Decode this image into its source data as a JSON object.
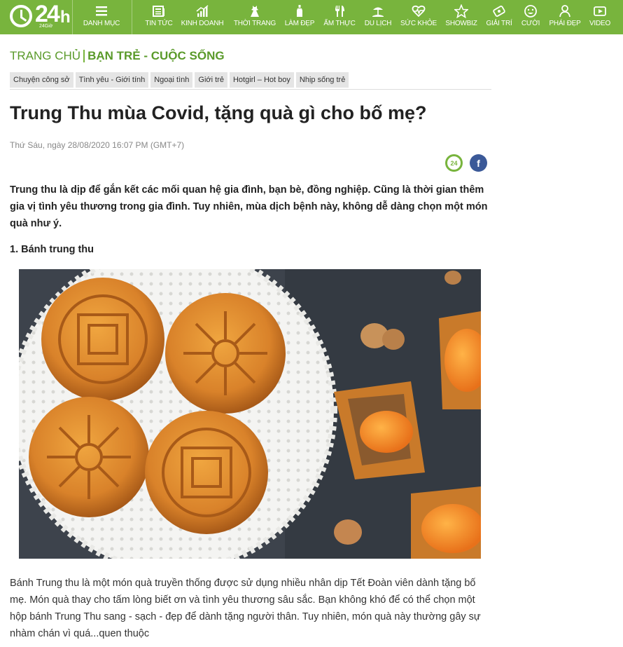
{
  "logo": {
    "text": "24",
    "suffix": "h",
    "sub": "24Giờ"
  },
  "nav": {
    "items": [
      {
        "label": "DANH MỤC",
        "icon": "menu-icon"
      },
      {
        "label": "TIN TỨC",
        "icon": "newspaper-icon"
      },
      {
        "label": "KINH DOANH",
        "icon": "chart-icon"
      },
      {
        "label": "THỜI TRANG",
        "icon": "dress-icon"
      },
      {
        "label": "LÀM ĐẸP",
        "icon": "bottle-icon"
      },
      {
        "label": "ẨM THỰC",
        "icon": "fork-knife-icon"
      },
      {
        "label": "DU LỊCH",
        "icon": "beach-icon"
      },
      {
        "label": "SỨC KHỎE",
        "icon": "heartbeat-icon"
      },
      {
        "label": "SHOWBIZ",
        "icon": "star-icon"
      },
      {
        "label": "GIẢI TRÍ",
        "icon": "ticket-icon"
      },
      {
        "label": "CƯỜI",
        "icon": "smile-icon"
      },
      {
        "label": "PHÁI ĐẸP",
        "icon": "woman-icon"
      },
      {
        "label": "VIDEO",
        "icon": "video-icon"
      }
    ]
  },
  "breadcrumb": {
    "home": "TRANG CHỦ",
    "category": "BẠN TRẺ - CUỘC SỐNG"
  },
  "tags": [
    "Chuyện công sở",
    "Tình yêu - Giới tính",
    "Ngoại tình",
    "Giới trẻ",
    "Hotgirl – Hot boy",
    "Nhịp sống trẻ"
  ],
  "article": {
    "title": "Trung Thu mùa Covid, tặng quà gì cho bố mẹ?",
    "date": "Thứ Sáu, ngày 28/08/2020 16:07 PM (GMT+7)",
    "share_24": "24",
    "share_fb": "f",
    "lead": "Trung thu là dịp để gắn kết các mối quan hệ gia đình, bạn bè, đồng nghiệp. Cũng là thời gian thêm gia vị tình yêu thương trong gia đình. Tuy nhiên, mùa dịch bệnh này, không dễ dàng chọn một món quà như ý.",
    "subheading": "1. Bánh trung thu",
    "paragraph": "Bánh Trung thu là một món quà truyền thống được sử dụng nhiều nhân dịp Tết Đoàn viên dành tặng bố mẹ. Món quà thay cho tấm lòng biết ơn và tình yêu thương sâu sắc. Bạn không khó để có thể chọn một hộp bánh Trung Thu sang - sạch - đẹp để dành tặng người thân. Tuy nhiên, món quà này thường gây sự nhàm chán vì quá...quen thuộc"
  },
  "colors": {
    "brand_green": "#78b43d",
    "breadcrumb_green": "#5a9a2a",
    "facebook_blue": "#3b5998"
  }
}
